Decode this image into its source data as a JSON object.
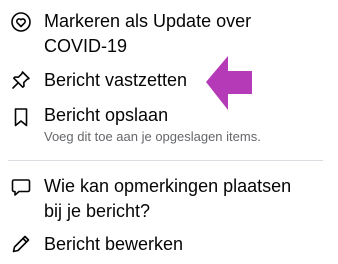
{
  "menu": {
    "items": [
      {
        "label_line1": "Markeren als Update over",
        "label_line2": "COVID-19",
        "icon": "covid-heart-icon"
      },
      {
        "label": "Bericht vastzetten",
        "icon": "pin-icon"
      },
      {
        "label": "Bericht opslaan",
        "sublabel": "Voeg dit toe aan je opgeslagen items.",
        "icon": "bookmark-icon"
      },
      {
        "label_line1": "Wie kan opmerkingen plaatsen",
        "label_line2": "bij je bericht?",
        "icon": "comment-icon"
      },
      {
        "label": "Bericht bewerken",
        "icon": "pencil-icon"
      }
    ]
  },
  "annotation": {
    "arrow_color": "#b43ab8",
    "icon": "arrow-left-icon"
  }
}
